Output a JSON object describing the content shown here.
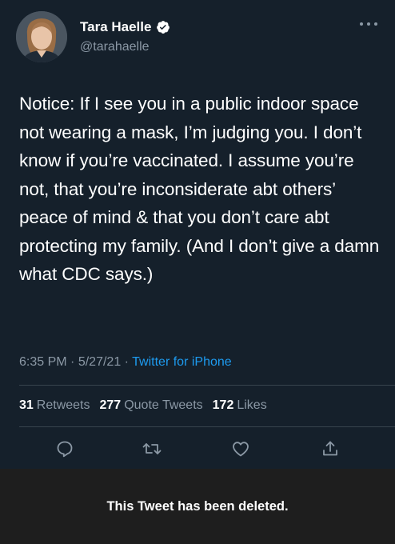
{
  "user": {
    "display_name": "Tara Haelle",
    "handle": "@tarahaelle",
    "verified_icon": "verified-badge-icon",
    "avatar_icon": "profile-photo"
  },
  "tweet": {
    "text": "Notice: If I see you in a public indoor space not wearing a mask, I’m judging you. I don’t know if you’re vaccinated. I assume you’re not, that you’re inconsiderate abt others’ peace of mind & that you don’t care abt protecting my family. (And I don’t give a damn what CDC says.)",
    "time": "6:35 PM",
    "date": "5/27/21",
    "source": "Twitter for iPhone",
    "separator": "·"
  },
  "stats": {
    "retweets_count": "31",
    "retweets_label": "Retweets",
    "quotes_count": "277",
    "quotes_label": "Quote Tweets",
    "likes_count": "172",
    "likes_label": "Likes"
  },
  "actions": [
    "reply-icon",
    "retweet-icon",
    "like-icon",
    "share-icon"
  ],
  "banner": {
    "message": "This Tweet has been deleted."
  },
  "colors": {
    "background": "#15202b",
    "secondary_text": "#8b98a5",
    "link": "#1d9bf0",
    "banner_bg": "#1e1e1e"
  }
}
